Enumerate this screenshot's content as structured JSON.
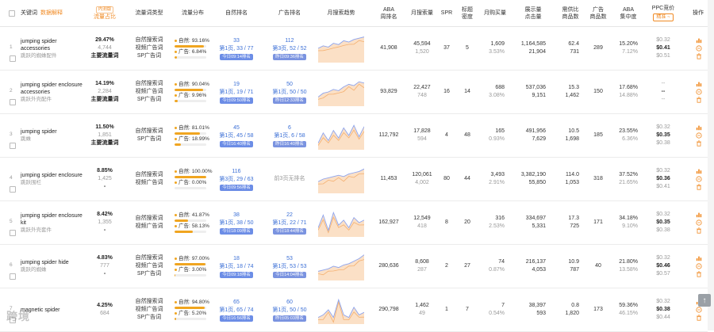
{
  "header": {
    "keyword": "关键词",
    "data_explain": "数据解释",
    "traffic_share_badge": "内测版",
    "traffic_share": "流量占比",
    "traffic_type": "流量词类型",
    "traffic_dist": "流量分布",
    "organic_rank": "自然排名",
    "ad_rank": "广告排名",
    "monthly_trend": "月搜索趋势",
    "aba_rank_1": "ABA",
    "aba_rank_2": "周排名",
    "monthly_search": "月搜索量",
    "spr": "SPR",
    "title_density_1": "标题",
    "title_density_2": "密度",
    "monthly_purchase": "月购买量",
    "impressions_1": "展示量",
    "impressions_2": "点击量",
    "supply_ratio_1": "需供比",
    "supply_ratio_2": "商品数",
    "ad_products_1": "广告",
    "ad_products_2": "商品数",
    "aba_conc_1": "ABA",
    "aba_conc_2": "集中度",
    "ppc_1": "PPC竞价",
    "ppc_btn": "精准 ~",
    "ops": "操作"
  },
  "rows": [
    {
      "no": "1",
      "kw": "jumping spider accessories",
      "kw_cn": "跳跃的蜘蛛配件",
      "share_pct": "29.47%",
      "share_n": "4,744",
      "share_label": "主要流量词",
      "types": [
        "自然搜索词",
        "视频广告词",
        "SP广告词"
      ],
      "organic_pct": "93.16%",
      "ad_pct": "6.84%",
      "organic_frac": 0.9316,
      "ad_frac": 0.0684,
      "org_rank": "33",
      "org_page": "第1页, 33 / 77",
      "org_tag": "今日09:14排名",
      "ad_rank": "112",
      "ad_page": "第3页, 52 / 52",
      "ad_tag": "昨日09:36排名",
      "aba": "41,908",
      "ms": "45,594",
      "ms2": "1,520",
      "spr": "37",
      "td": "5",
      "mp": "1,609",
      "mp2": "3.53%",
      "imp": "1,164,585",
      "clk": "21,904",
      "sr": "62.4",
      "sr2": "731",
      "adp": "289",
      "conc": "15.20%",
      "conc2": "7.12%",
      "ppc1": "$0.32",
      "ppc2": "$0.41",
      "ppc3": "$0.51",
      "trend": [
        0.5,
        0.6,
        0.55,
        0.7,
        0.65,
        0.8,
        0.75,
        0.85,
        0.9,
        0.95
      ]
    },
    {
      "no": "2",
      "kw": "jumping spider enclosure accessories",
      "kw_cn": "跳跃外壳配件",
      "share_pct": "14.19%",
      "share_n": "2,284",
      "share_label": "主要流量词",
      "types": [
        "自然搜索词",
        "视频广告词",
        "SP广告词"
      ],
      "organic_pct": "90.04%",
      "ad_pct": "9.96%",
      "organic_frac": 0.9004,
      "ad_frac": 0.0996,
      "org_rank": "19",
      "org_page": "第1页, 19 / 71",
      "org_tag": "今日09:50排名",
      "ad_rank": "50",
      "ad_page": "第1页, 50 / 50",
      "ad_tag": "昨日12:33排名",
      "aba": "93,829",
      "ms": "22,427",
      "ms2": "748",
      "spr": "16",
      "td": "14",
      "mp": "688",
      "mp2": "3.08%",
      "imp": "537,036",
      "clk": "9,151",
      "sr": "15.3",
      "sr2": "1,462",
      "adp": "150",
      "conc": "17.68%",
      "conc2": "14.88%",
      "ppc1": "--",
      "ppc2": "--",
      "ppc3": "--",
      "trend": [
        0.3,
        0.45,
        0.5,
        0.6,
        0.55,
        0.7,
        0.8,
        0.75,
        0.9,
        0.85
      ]
    },
    {
      "no": "3",
      "kw": "jumping spider",
      "kw_cn": "跳蛛",
      "share_pct": "11.50%",
      "share_n": "1,851",
      "share_label": "主要流量词",
      "types": [
        "自然搜索词",
        "SP广告词"
      ],
      "organic_pct": "81.01%",
      "ad_pct": "18.99%",
      "organic_frac": 0.8101,
      "ad_frac": 0.1899,
      "org_rank": "45",
      "org_page": "第1页, 45 / 58",
      "org_tag": "今日16:40排名",
      "ad_rank": "6",
      "ad_page": "第1页, 6 / 58",
      "ad_tag": "昨日16:40排名",
      "aba": "112,792",
      "ms": "17,828",
      "ms2": "594",
      "spr": "4",
      "td": "48",
      "mp": "165",
      "mp2": "0.93%",
      "imp": "491,956",
      "clk": "7,629",
      "sr": "10.5",
      "sr2": "1,698",
      "adp": "185",
      "conc": "23.55%",
      "conc2": "6.36%",
      "ppc1": "$0.32",
      "ppc2": "$0.35",
      "ppc3": "$0.38",
      "trend": [
        0.2,
        0.6,
        0.3,
        0.7,
        0.4,
        0.8,
        0.5,
        0.9,
        0.45,
        0.85
      ]
    },
    {
      "no": "4",
      "kw": "jumping spider enclosure",
      "kw_cn": "跳跃围栏",
      "share_pct": "8.85%",
      "share_n": "1,425",
      "share_label": "-",
      "types": [
        "自然搜索词",
        "视频广告词"
      ],
      "organic_pct": "100.00%",
      "ad_pct": "0.00%",
      "organic_frac": 1.0,
      "ad_frac": 0.0,
      "org_rank": "116",
      "org_page": "第3页, 29 / 63",
      "org_tag": "今日09:56排名",
      "ad_rank": "",
      "ad_page": "前3页无排名",
      "ad_tag": "",
      "aba": "11,453",
      "ms": "120,061",
      "ms2": "4,002",
      "spr": "80",
      "td": "44",
      "mp": "3,493",
      "mp2": "2.91%",
      "imp": "3,382,190",
      "clk": "55,850",
      "sr": "114.0",
      "sr2": "1,053",
      "adp": "318",
      "conc": "37.52%",
      "conc2": "21.65%",
      "ppc1": "$0.32",
      "ppc2": "$0.36",
      "ppc3": "$0.41",
      "trend": [
        0.4,
        0.5,
        0.55,
        0.6,
        0.65,
        0.6,
        0.7,
        0.75,
        0.8,
        0.9
      ]
    },
    {
      "no": "5",
      "kw": "jumping spider enclosure kit",
      "kw_cn": "跳跃外壳套件",
      "share_pct": "8.42%",
      "share_n": "1,355",
      "share_label": "-",
      "types": [
        "自然搜索词",
        "视频广告词"
      ],
      "organic_pct": "41.87%",
      "ad_pct": "58.13%",
      "organic_frac": 0.4187,
      "ad_frac": 0.5813,
      "org_rank": "38",
      "org_page": "第1页, 38 / 50",
      "org_tag": "今日18:09排名",
      "ad_rank": "22",
      "ad_page": "第1页, 22 / 71",
      "ad_tag": "今日18:44排名",
      "aba": "162,927",
      "ms": "12,549",
      "ms2": "418",
      "spr": "8",
      "td": "20",
      "mp": "316",
      "mp2": "2.53%",
      "imp": "334,697",
      "clk": "5,331",
      "sr": "17.3",
      "sr2": "725",
      "adp": "171",
      "conc": "34.18%",
      "conc2": "9.10%",
      "ppc1": "$0.32",
      "ppc2": "$0.35",
      "ppc3": "$0.38",
      "trend": [
        0.3,
        0.8,
        0.2,
        0.9,
        0.4,
        0.6,
        0.3,
        0.7,
        0.5,
        0.6
      ]
    },
    {
      "no": "6",
      "kw": "jumping spider hide",
      "kw_cn": "跳跃的蜘蛛",
      "share_pct": "4.83%",
      "share_n": "777",
      "share_label": "-",
      "types": [
        "自然搜索词",
        "视频广告词",
        "SP广告词"
      ],
      "organic_pct": "97.00%",
      "ad_pct": "3.00%",
      "organic_frac": 0.97,
      "ad_frac": 0.03,
      "org_rank": "18",
      "org_page": "第1页, 18 / 74",
      "org_tag": "今日09:18排名",
      "ad_rank": "53",
      "ad_page": "第1页, 53 / 53",
      "ad_tag": "今日14:04排名",
      "aba": "280,636",
      "ms": "8,608",
      "ms2": "287",
      "spr": "2",
      "td": "27",
      "mp": "74",
      "mp2": "0.87%",
      "imp": "216,137",
      "clk": "4,053",
      "sr": "10.9",
      "sr2": "787",
      "adp": "40",
      "conc": "21.80%",
      "conc2": "13.58%",
      "ppc1": "$0.32",
      "ppc2": "$0.46",
      "ppc3": "$0.57",
      "trend": [
        0.3,
        0.35,
        0.4,
        0.5,
        0.45,
        0.55,
        0.6,
        0.7,
        0.8,
        0.95
      ]
    },
    {
      "no": "7",
      "kw": "magnetic spider",
      "kw_cn": "",
      "share_pct": "4.25%",
      "share_n": "684",
      "share_label": "",
      "types": [
        "自然搜索词",
        "视频广告词",
        "SP广告词"
      ],
      "organic_pct": "94.80%",
      "ad_pct": "5.20%",
      "organic_frac": 0.948,
      "ad_frac": 0.052,
      "org_rank": "65",
      "org_page": "第1页, 65 / 74",
      "org_tag": "今日16:56排名",
      "ad_rank": "60",
      "ad_page": "第1页, 50 / 50",
      "ad_tag": "昨日05:03排名",
      "aba": "290,798",
      "ms": "1,462",
      "ms2": "49",
      "spr": "1",
      "td": "7",
      "mp": "7",
      "mp2": "0.54%",
      "imp": "38,397",
      "clk": "593",
      "sr": "0.8",
      "sr2": "1,820",
      "adp": "173",
      "conc": "59.36%",
      "conc2": "46.15%",
      "ppc1": "$0.32",
      "ppc2": "$0.38",
      "ppc3": "$0.44",
      "trend": [
        0.2,
        0.3,
        0.5,
        0.2,
        0.9,
        0.3,
        0.2,
        0.6,
        0.3,
        0.4
      ]
    }
  ],
  "watermark": "跨境",
  "scroll_top_icon": "arrow-up-icon"
}
